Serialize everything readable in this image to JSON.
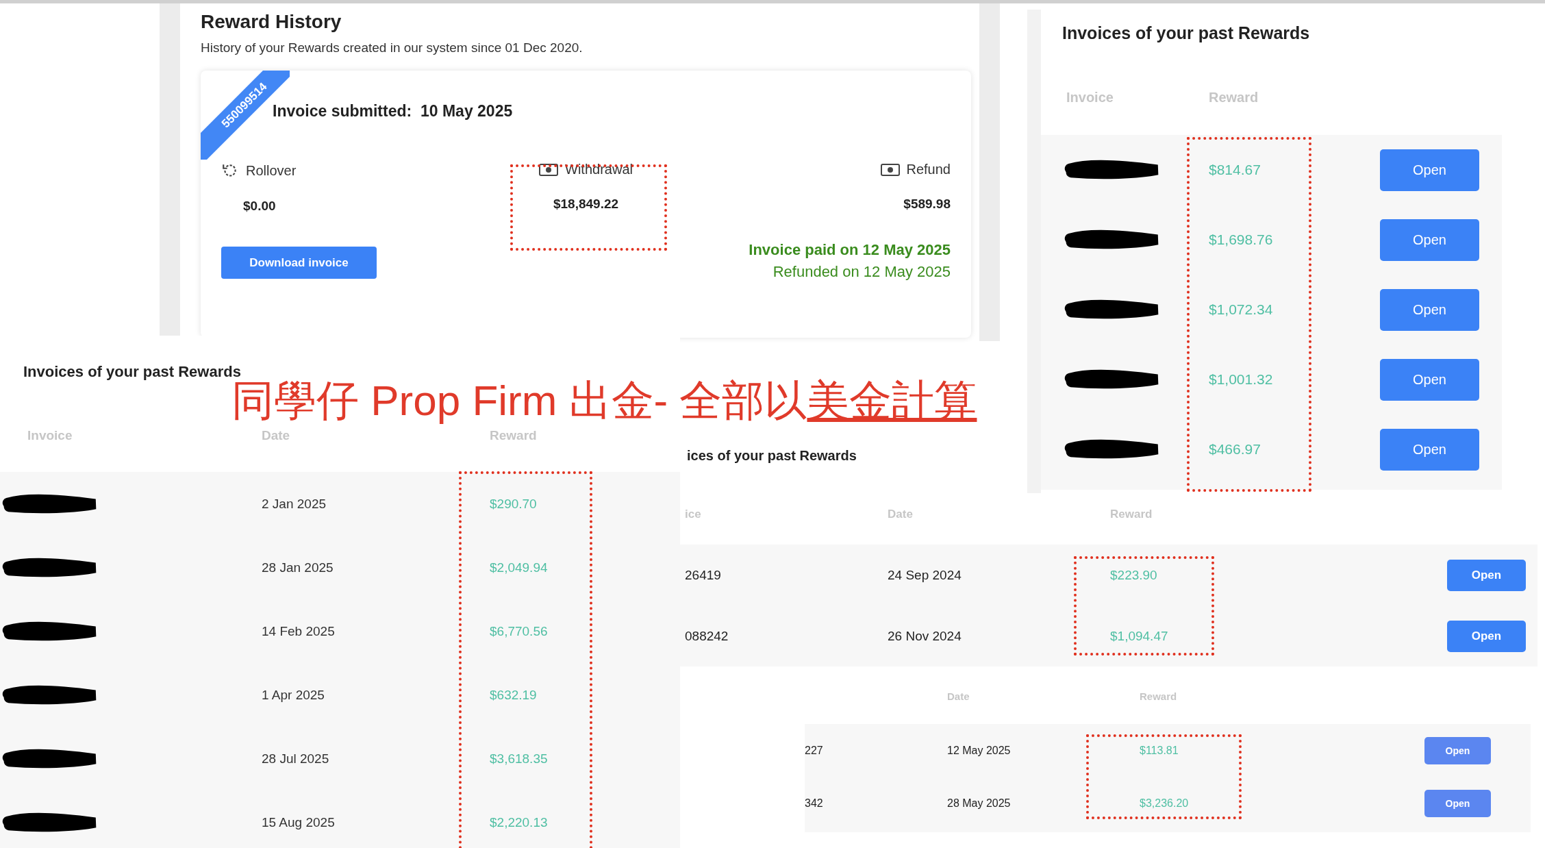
{
  "reward_history": {
    "title": "Reward History",
    "subtitle": "History of your Rewards created in our system since 01 Dec 2020.",
    "card": {
      "invoice_number": "550099514",
      "submitted": "Invoice submitted:  10 May 2025",
      "amounts": [
        {
          "kind": "rollover",
          "label": "Rollover",
          "value": "$0.00"
        },
        {
          "kind": "withdrawal",
          "label": "Withdrawal",
          "value": "$18,849.22"
        },
        {
          "kind": "refund",
          "label": "Refund",
          "value": "$589.98"
        }
      ],
      "download_button": "Download invoice",
      "paid_status": "Invoice paid on 12 May 2025",
      "refund_status": "Refunded on 12 May 2025"
    }
  },
  "invoice_panels": [
    {
      "title": "Invoices of your past Rewards",
      "columns": [
        {
          "kind": "invoice",
          "label": "Invoice"
        },
        {
          "kind": "reward",
          "label": "Reward"
        }
      ],
      "rows": [
        {
          "redacted": true,
          "reward": "$814.67",
          "button": "Open"
        },
        {
          "redacted": true,
          "reward": "$1,698.76",
          "button": "Open"
        },
        {
          "redacted": true,
          "reward": "$1,072.34",
          "button": "Open"
        },
        {
          "redacted": true,
          "reward": "$1,001.32",
          "button": "Open"
        },
        {
          "redacted": true,
          "reward": "$466.97",
          "button": "Open"
        }
      ]
    },
    {
      "title": "Invoices of your past Rewards",
      "columns": [
        {
          "kind": "invoice",
          "label": "Invoice"
        },
        {
          "kind": "date",
          "label": "Date"
        },
        {
          "kind": "reward",
          "label": "Reward"
        }
      ],
      "rows": [
        {
          "redacted": true,
          "date": "2 Jan 2025",
          "reward": "$290.70"
        },
        {
          "redacted": true,
          "date": "28 Jan 2025",
          "reward": "$2,049.94"
        },
        {
          "redacted": true,
          "date": "14 Feb 2025",
          "reward": "$6,770.56"
        },
        {
          "redacted": true,
          "date": "1 Apr 2025",
          "reward": "$632.19"
        },
        {
          "redacted": true,
          "date": "28 Jul 2025",
          "reward": "$3,618.35"
        },
        {
          "redacted": true,
          "date": "15 Aug 2025",
          "reward": "$2,220.13"
        }
      ]
    },
    {
      "title": "ices of your past Rewards",
      "columns": [
        {
          "kind": "invoice",
          "label": "ice"
        },
        {
          "kind": "date",
          "label": "Date"
        },
        {
          "kind": "reward",
          "label": "Reward"
        }
      ],
      "rows": [
        {
          "redacted": false,
          "invoice": "26419",
          "date": "24 Sep 2024",
          "reward": "$223.90",
          "button": "Open"
        },
        {
          "redacted": false,
          "invoice": "088242",
          "date": "26 Nov 2024",
          "reward": "$1,094.47",
          "button": "Open"
        }
      ]
    },
    {
      "columns": [
        {
          "kind": "date",
          "label": "Date"
        },
        {
          "kind": "reward",
          "label": "Reward"
        }
      ],
      "rows": [
        {
          "redacted": false,
          "invoice": "227",
          "date": "12 May 2025",
          "reward": "$113.81",
          "button": "Open"
        },
        {
          "redacted": false,
          "invoice": "342",
          "date": "28 May 2025",
          "reward": "$3,236.20",
          "button": "Open"
        }
      ]
    }
  ],
  "caption": {
    "text": "同學仔 Prop Firm 出金- 全部以",
    "underlined": "美金計算"
  }
}
